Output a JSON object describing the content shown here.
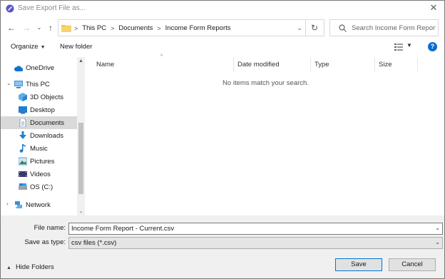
{
  "window": {
    "title": "Save Export File as..."
  },
  "address_bar": {
    "crumbs": [
      "This PC",
      "Documents",
      "Income Form Reports"
    ]
  },
  "search": {
    "placeholder": "Search Income Form Reports"
  },
  "toolbar": {
    "organize_label": "Organize",
    "new_folder_label": "New folder"
  },
  "sidebar": {
    "items": [
      {
        "label": "OneDrive",
        "icon": "cloud-icon"
      },
      {
        "label": "This PC",
        "icon": "computer-icon"
      },
      {
        "label": "3D Objects",
        "icon": "cube-icon"
      },
      {
        "label": "Desktop",
        "icon": "desktop-icon"
      },
      {
        "label": "Documents",
        "icon": "document-icon",
        "selected": true
      },
      {
        "label": "Downloads",
        "icon": "download-icon"
      },
      {
        "label": "Music",
        "icon": "music-icon"
      },
      {
        "label": "Pictures",
        "icon": "pictures-icon"
      },
      {
        "label": "Videos",
        "icon": "video-icon"
      },
      {
        "label": "OS (C:)",
        "icon": "drive-icon"
      },
      {
        "label": "Network",
        "icon": "network-icon"
      }
    ]
  },
  "file_list": {
    "columns": [
      "Name",
      "Date modified",
      "Type",
      "Size"
    ],
    "empty_message": "No items match your search."
  },
  "form": {
    "file_name_label": "File name:",
    "file_name_value": "Income Form Report - Current.csv",
    "save_as_type_label": "Save as type:",
    "save_as_type_value": "csv files (*.csv)"
  },
  "footer": {
    "hide_folders_label": "Hide Folders",
    "save_label": "Save",
    "cancel_label": "Cancel"
  },
  "colors": {
    "accent": "#0078d7",
    "help": "#0b6bd0",
    "folder": "#f0c24a",
    "selected_row": "#d9d9d9"
  }
}
